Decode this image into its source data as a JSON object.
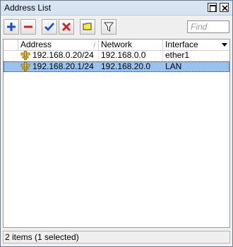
{
  "window": {
    "title": "Address List"
  },
  "toolbar": {
    "find_placeholder": "Find",
    "buttons": [
      "add-icon",
      "remove-icon",
      "enable-icon",
      "disable-icon",
      "comment-icon",
      "filter-icon"
    ]
  },
  "table": {
    "columns": [
      "Address",
      "Network",
      "Interface"
    ],
    "rows": [
      {
        "address": "192.168.0.20/24",
        "network": "192.168.0.0",
        "interface": "ether1",
        "selected": false
      },
      {
        "address": "192.168.20.1/24",
        "network": "192.168.20.0",
        "interface": "LAN",
        "selected": true
      }
    ]
  },
  "status": {
    "text": "2 items (1 selected)"
  },
  "colors": {
    "selection": "#99c2ef",
    "titlebar": "#d7e4f2",
    "add": "#1f4fd6",
    "remove": "#d42020",
    "enable": "#1f4fd6",
    "disable": "#d42020"
  }
}
